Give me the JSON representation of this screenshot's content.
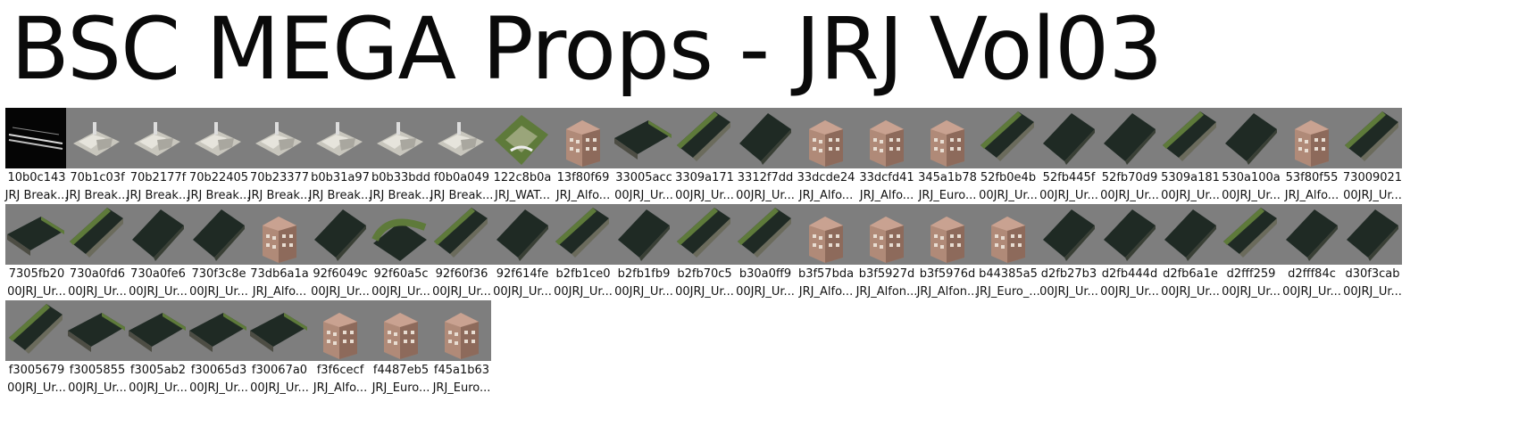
{
  "title": "BSC MEGA Props - JRJ Vol03",
  "items": [
    {
      "id": "10b0c143",
      "name": "JRJ Break...",
      "icon": "rail-track-icon"
    },
    {
      "id": "70b1c03f",
      "name": "JRJ Break...",
      "icon": "rubble-icon"
    },
    {
      "id": "70b2177f",
      "name": "JRJ Break...",
      "icon": "rubble-icon"
    },
    {
      "id": "70b22405",
      "name": "JRJ Break...",
      "icon": "rubble-icon"
    },
    {
      "id": "70b23377",
      "name": "JRJ Break...",
      "icon": "rubble-icon"
    },
    {
      "id": "b0b31a97",
      "name": "JRJ Break...",
      "icon": "rubble-icon"
    },
    {
      "id": "b0b33bdd",
      "name": "JRJ Break...",
      "icon": "rubble-icon"
    },
    {
      "id": "f0b0a049",
      "name": "JRJ Break...",
      "icon": "rubble-icon"
    },
    {
      "id": "122c8b0a",
      "name": "JRJ_WAT...",
      "icon": "water-feature-icon"
    },
    {
      "id": "13f80f69",
      "name": "JRJ_Alfo...",
      "icon": "building-icon"
    },
    {
      "id": "33005acc",
      "name": "00JRJ_Ur...",
      "icon": "canal-icon"
    },
    {
      "id": "3309a171",
      "name": "00JRJ_Ur...",
      "icon": "canal-edge-icon"
    },
    {
      "id": "3312f7dd",
      "name": "00JRJ_Ur...",
      "icon": "water-tile-icon"
    },
    {
      "id": "33dcde24",
      "name": "JRJ_Alfo...",
      "icon": "building-icon"
    },
    {
      "id": "33dcfd41",
      "name": "JRJ_Alfo...",
      "icon": "building-icon"
    },
    {
      "id": "345a1b78",
      "name": "JRJ_Euro...",
      "icon": "building-icon"
    },
    {
      "id": "52fb0e4b",
      "name": "00JRJ_Ur...",
      "icon": "canal-edge-icon"
    },
    {
      "id": "52fb445f",
      "name": "00JRJ_Ur...",
      "icon": "water-tile-icon"
    },
    {
      "id": "52fb70d9",
      "name": "00JRJ_Ur...",
      "icon": "water-tile-icon"
    },
    {
      "id": "5309a181",
      "name": "00JRJ_Ur...",
      "icon": "canal-edge-icon"
    },
    {
      "id": "530a100a",
      "name": "00JRJ_Ur...",
      "icon": "water-tile-icon"
    },
    {
      "id": "53f80f55",
      "name": "JRJ_Alfo...",
      "icon": "building-icon"
    },
    {
      "id": "73009021",
      "name": "00JRJ_Ur...",
      "icon": "canal-edge-icon"
    },
    {
      "id": "7305fb20",
      "name": "00JRJ_Ur...",
      "icon": "canal-icon"
    },
    {
      "id": "730a0fd6",
      "name": "00JRJ_Ur...",
      "icon": "canal-edge-icon"
    },
    {
      "id": "730a0fe6",
      "name": "00JRJ_Ur...",
      "icon": "water-tile-icon"
    },
    {
      "id": "730f3c8e",
      "name": "00JRJ_Ur...",
      "icon": "water-tile-icon"
    },
    {
      "id": "73db6a1a",
      "name": "JRJ_Alfo...",
      "icon": "building-icon"
    },
    {
      "id": "92f6049c",
      "name": "00JRJ_Ur...",
      "icon": "water-tile-icon"
    },
    {
      "id": "92f60a5c",
      "name": "00JRJ_Ur...",
      "icon": "canal-curve-icon"
    },
    {
      "id": "92f60f36",
      "name": "00JRJ_Ur...",
      "icon": "canal-edge-icon"
    },
    {
      "id": "92f614fe",
      "name": "00JRJ_Ur...",
      "icon": "water-tile-icon"
    },
    {
      "id": "b2fb1ce0",
      "name": "00JRJ_Ur...",
      "icon": "canal-edge-icon"
    },
    {
      "id": "b2fb1fb9",
      "name": "00JRJ_Ur...",
      "icon": "water-tile-icon"
    },
    {
      "id": "b2fb70c5",
      "name": "00JRJ_Ur...",
      "icon": "canal-edge-icon"
    },
    {
      "id": "b30a0ff9",
      "name": "00JRJ_Ur...",
      "icon": "canal-edge-icon"
    },
    {
      "id": "b3f57bda",
      "name": "JRJ_Alfo...",
      "icon": "building-icon"
    },
    {
      "id": "b3f5927d",
      "name": "JRJ_Alfon...",
      "icon": "building-icon"
    },
    {
      "id": "b3f5976d",
      "name": "JRJ_Alfon...",
      "icon": "building-icon"
    },
    {
      "id": "b44385a5",
      "name": "JRJ_Euro_...",
      "icon": "building-icon"
    },
    {
      "id": "d2fb27b3",
      "name": "00JRJ_Ur...",
      "icon": "water-tile-icon"
    },
    {
      "id": "d2fb444d",
      "name": "00JRJ_Ur...",
      "icon": "water-tile-icon"
    },
    {
      "id": "d2fb6a1e",
      "name": "00JRJ_Ur...",
      "icon": "water-tile-icon"
    },
    {
      "id": "d2fff259",
      "name": "00JRJ_Ur...",
      "icon": "canal-edge-icon"
    },
    {
      "id": "d2fff84c",
      "name": "00JRJ_Ur...",
      "icon": "water-tile-icon"
    },
    {
      "id": "d30f3cab",
      "name": "00JRJ_Ur...",
      "icon": "water-tile-icon"
    },
    {
      "id": "f3005679",
      "name": "00JRJ_Ur...",
      "icon": "canal-edge-icon"
    },
    {
      "id": "f3005855",
      "name": "00JRJ_Ur...",
      "icon": "canal-icon"
    },
    {
      "id": "f3005ab2",
      "name": "00JRJ_Ur...",
      "icon": "canal-icon"
    },
    {
      "id": "f30065d3",
      "name": "00JRJ_Ur...",
      "icon": "canal-icon"
    },
    {
      "id": "f30067a0",
      "name": "00JRJ_Ur...",
      "icon": "canal-icon"
    },
    {
      "id": "f3f6cecf",
      "name": "JRJ_Alfo...",
      "icon": "building-icon"
    },
    {
      "id": "f4487eb5",
      "name": "JRJ_Euro...",
      "icon": "building-icon"
    },
    {
      "id": "f45a1b63",
      "name": "JRJ_Euro...",
      "icon": "building-icon"
    }
  ],
  "colors": {
    "thumb_bg": "#7e7e7e",
    "water": "#1f2a24",
    "grass": "#5e7a3a",
    "stone": "#c8c6bd",
    "building": "#b08a78"
  }
}
